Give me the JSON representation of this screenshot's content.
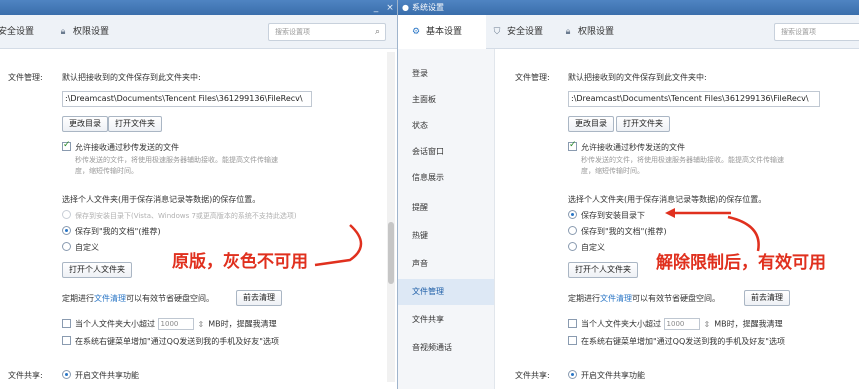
{
  "left": {
    "title_controls": {
      "minimize": "_",
      "close": "×"
    },
    "tabs": [
      {
        "label": "安全设置",
        "icon": "shield-icon"
      },
      {
        "label": "权限设置",
        "icon": "lock-icon"
      }
    ],
    "search": {
      "placeholder": "搜索设置项",
      "icon": "search-icon"
    },
    "file_mgmt": {
      "label": "文件管理:",
      "intro": "默认把接收到的文件保存到此文件夹中:",
      "path": ":\\Dreamcast\\Documents\\Tencent Files\\361299136\\FileRecv\\",
      "change_dir": "更改目录",
      "open_folder": "打开文件夹",
      "allow_flash": "允许接收通过秒传发送的文件",
      "flash_desc1": "秒传发送的文件，将使用极速服务器辅助接收。能提高文件传输速",
      "flash_desc2": "度，缩短传输时间。",
      "choose_folder": "选择个人文件夹(用于保存消息记录等数据)的保存位置。",
      "opt_install_dir": "保存到安装目录下(Vista、Windows 7或更高版本的系统不支持此选项)",
      "opt_my_docs": "保存到\"我的文档\"(推荐)",
      "opt_custom": "自定义",
      "open_personal": "打开个人文件夹",
      "cleanup_pre": "定期进行",
      "cleanup_link": "文件清理",
      "cleanup_post": "可以有效节省硬盘空间。",
      "go_cleanup": "前去清理",
      "size_pre": "当个人文件夹大小超过",
      "size_value": "1000",
      "size_post": "MB时，提醒我清理",
      "context_menu": "在系统右键菜单增加\"通过QQ发送到我的手机及好友\"选项"
    },
    "annotation": "原版，灰色不可用",
    "file_share": {
      "label": "文件共享:",
      "option": "开启文件共享功能"
    }
  },
  "right": {
    "window_title": "系统设置",
    "tabs": [
      {
        "label": "基本设置",
        "icon": "gear-icon"
      },
      {
        "label": "安全设置",
        "icon": "shield-icon"
      },
      {
        "label": "权限设置",
        "icon": "lock-icon"
      }
    ],
    "search": {
      "placeholder": "搜索设置项"
    },
    "nav": [
      "登录",
      "主面板",
      "状态",
      "会话窗口",
      "信息展示",
      "提醒",
      "热键",
      "声音",
      "文件管理",
      "文件共享",
      "音视频通话"
    ],
    "nav_active": "文件管理",
    "file_mgmt": {
      "label": "文件管理:",
      "intro": "默认把接收到的文件保存到此文件夹中:",
      "path": ":\\Dreamcast\\Documents\\Tencent Files\\361299136\\FileRecv\\",
      "change_dir": "更改目录",
      "open_folder": "打开文件夹",
      "allow_flash": "允许接收通过秒传发送的文件",
      "flash_desc1": "秒传发送的文件，将使用极速服务器辅助接收。能提高文件传输速",
      "flash_desc2": "度，缩短传输时间。",
      "choose_folder": "选择个人文件夹(用于保存消息记录等数据)的保存位置。",
      "opt_install_dir": "保存到安装目录下",
      "opt_my_docs": "保存到\"我的文档\"(推荐)",
      "opt_custom": "自定义",
      "open_personal": "打开个人文件夹",
      "cleanup_pre": "定期进行",
      "cleanup_link": "文件清理",
      "cleanup_post": "可以有效节省硬盘空间。",
      "go_cleanup": "前去清理",
      "size_pre": "当个人文件夹大小超过",
      "size_value": "1000",
      "size_post": "MB时，提醒我清理",
      "context_menu": "在系统右键菜单增加\"通过QQ发送到我的手机及好友\"选项"
    },
    "annotation": "解除限制后，有效可用",
    "file_share": {
      "label": "文件共享:",
      "option": "开启文件共享功能"
    }
  },
  "colors": {
    "accent": "#2a76c6",
    "annotation": "#e0301e",
    "titlebar": "#3a6eab"
  }
}
